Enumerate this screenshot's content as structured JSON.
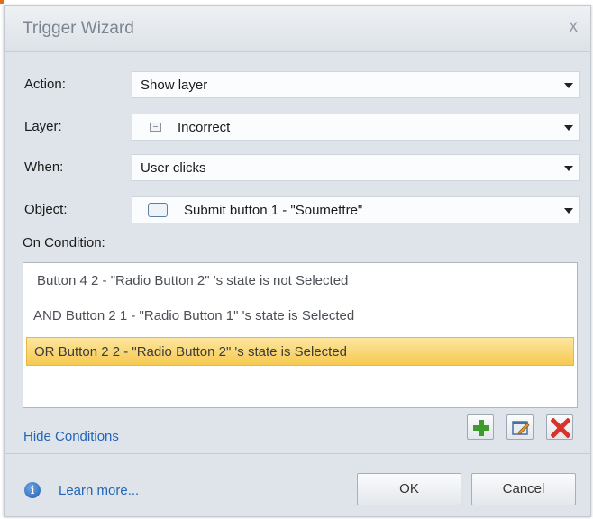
{
  "window": {
    "title": "Trigger Wizard",
    "close_label": "x"
  },
  "form": {
    "action": {
      "label": "Action:",
      "value": "Show layer"
    },
    "layer": {
      "label": "Layer:",
      "value": "Incorrect"
    },
    "when": {
      "label": "When:",
      "value": "User clicks"
    },
    "object": {
      "label": "Object:",
      "value": "Submit button 1 - \"Soumettre\""
    },
    "conditions_label": "On Condition:"
  },
  "conditions": [
    {
      "text": "Button 4 2 - \"Radio Button 2\" 's state is not Selected",
      "selected": false
    },
    {
      "text": "AND Button 2 1 - \"Radio Button 1\" 's state is Selected",
      "selected": false
    },
    {
      "text": "OR Button 2 2 - \"Radio Button 2\" 's state is Selected",
      "selected": true
    }
  ],
  "links": {
    "hide_conditions": "Hide Conditions",
    "learn_more": "Learn more..."
  },
  "buttons": {
    "ok": "OK",
    "cancel": "Cancel"
  },
  "icons": {
    "add": "add-condition-icon",
    "edit": "edit-condition-icon",
    "delete": "delete-condition-icon",
    "info": "info-icon"
  },
  "colors": {
    "selection": "#f6c94f",
    "link": "#2366b5",
    "add_icon": "#3f9b2c",
    "delete_icon": "#d8322a"
  }
}
